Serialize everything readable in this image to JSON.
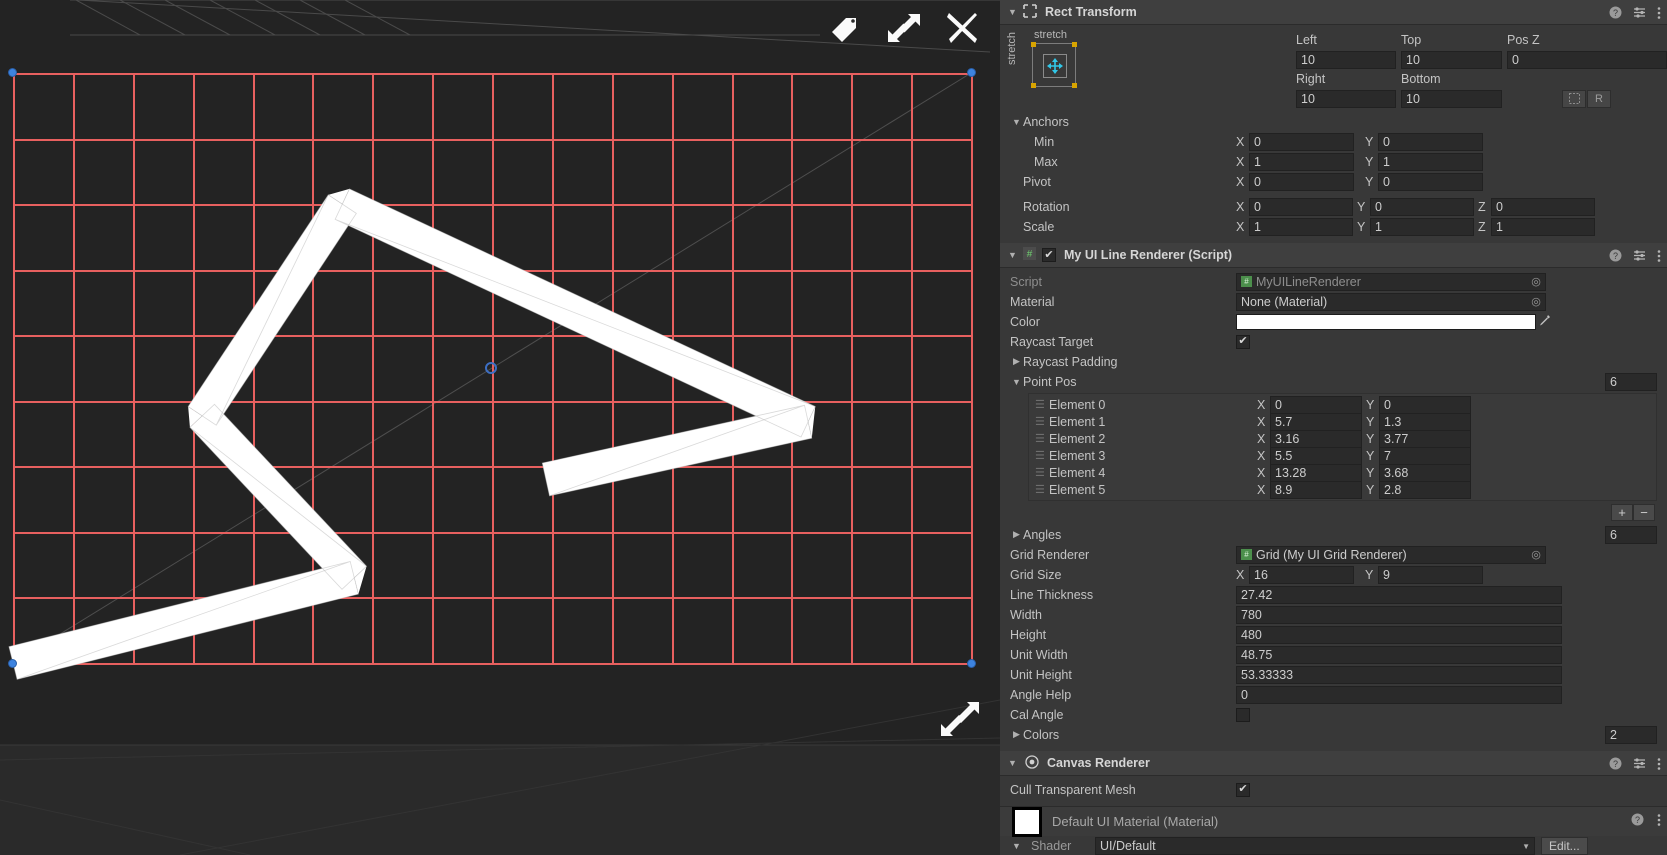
{
  "scene": {
    "toolbar": [
      {
        "name": "tag-icon",
        "label": "Tag"
      },
      {
        "name": "expand-diagonal-icon",
        "label": "Expand"
      },
      {
        "name": "close-icon",
        "label": "Close"
      }
    ],
    "bottom_resize": {
      "name": "resize-diagonal-icon",
      "label": "Resize"
    },
    "grid": {
      "columns": 16,
      "rows": 9,
      "line_color": "#e8605f",
      "background": "#232323",
      "handle_color": "#3d83df",
      "pivot_color": "#3d6fc4"
    },
    "line": {
      "color": "#ffffff",
      "wire_color": "#b9b9b9",
      "points": [
        {
          "x": 0,
          "y": 0
        },
        {
          "x": 5.7,
          "y": 1.3
        },
        {
          "x": 3.16,
          "y": 3.77
        },
        {
          "x": 5.5,
          "y": 7
        },
        {
          "x": 13.28,
          "y": 3.68
        },
        {
          "x": 8.9,
          "y": 2.8
        }
      ]
    }
  },
  "inspector": {
    "rect_transform": {
      "title": "Rect Transform",
      "anchor_preset": {
        "top_label": "stretch",
        "left_label": "stretch"
      },
      "fields": {
        "left_label": "Left",
        "left_value": "10",
        "top_label": "Top",
        "top_value": "10",
        "posz_label": "Pos Z",
        "posz_value": "0",
        "right_label": "Right",
        "right_value": "10",
        "bottom_label": "Bottom",
        "bottom_value": "10"
      },
      "blueprint_label": "",
      "raw_label": "R",
      "anchors_label": "Anchors",
      "min_label": "Min",
      "min_x": "0",
      "min_y": "0",
      "max_label": "Max",
      "max_x": "1",
      "max_y": "1",
      "pivot_label": "Pivot",
      "pivot_x": "0",
      "pivot_y": "0",
      "rotation_label": "Rotation",
      "rot_x": "0",
      "rot_y": "0",
      "rot_z": "0",
      "scale_label": "Scale",
      "scale_x": "1",
      "scale_y": "1",
      "scale_z": "1"
    },
    "line_renderer": {
      "title": "My UI Line Renderer (Script)",
      "enabled": true,
      "script_label": "Script",
      "script_value": "MyUILineRenderer",
      "material_label": "Material",
      "material_value": "None (Material)",
      "color_label": "Color",
      "color_value": "#ffffff",
      "raycast_target_label": "Raycast Target",
      "raycast_target_checked": true,
      "raycast_padding_label": "Raycast Padding",
      "point_pos_label": "Point Pos",
      "point_pos_size": "6",
      "elements": [
        {
          "name": "Element 0",
          "x": "0",
          "y": "0"
        },
        {
          "name": "Element 1",
          "x": "5.7",
          "y": "1.3"
        },
        {
          "name": "Element 2",
          "x": "3.16",
          "y": "3.77"
        },
        {
          "name": "Element 3",
          "x": "5.5",
          "y": "7"
        },
        {
          "name": "Element 4",
          "x": "13.28",
          "y": "3.68"
        },
        {
          "name": "Element 5",
          "x": "8.9",
          "y": "2.8"
        }
      ],
      "add_label": "+",
      "remove_label": "−",
      "angles_label": "Angles",
      "angles_size": "6",
      "grid_renderer_label": "Grid Renderer",
      "grid_renderer_value": "Grid (My UI Grid Renderer)",
      "grid_size_label": "Grid Size",
      "grid_size_x": "16",
      "grid_size_y": "9",
      "line_thickness_label": "Line Thickness",
      "line_thickness_value": "27.42",
      "width_label": "Width",
      "width_value": "780",
      "height_label": "Height",
      "height_value": "480",
      "unit_width_label": "Unit Width",
      "unit_width_value": "48.75",
      "unit_height_label": "Unit Height",
      "unit_height_value": "53.33333",
      "angle_help_label": "Angle Help",
      "angle_help_value": "0",
      "cal_angle_label": "Cal Angle",
      "cal_angle_checked": false,
      "colors_label": "Colors",
      "colors_size": "2"
    },
    "canvas_renderer": {
      "title": "Canvas Renderer",
      "cull_label": "Cull Transparent Mesh",
      "cull_checked": true
    },
    "material": {
      "title": "Default UI Material (Material)",
      "shader_label": "Shader",
      "shader_value": "UI/Default",
      "edit_label": "Edit..."
    },
    "icons": {
      "help": "help-icon",
      "preset": "preset-icon",
      "menu": "kebab-menu-icon"
    }
  }
}
